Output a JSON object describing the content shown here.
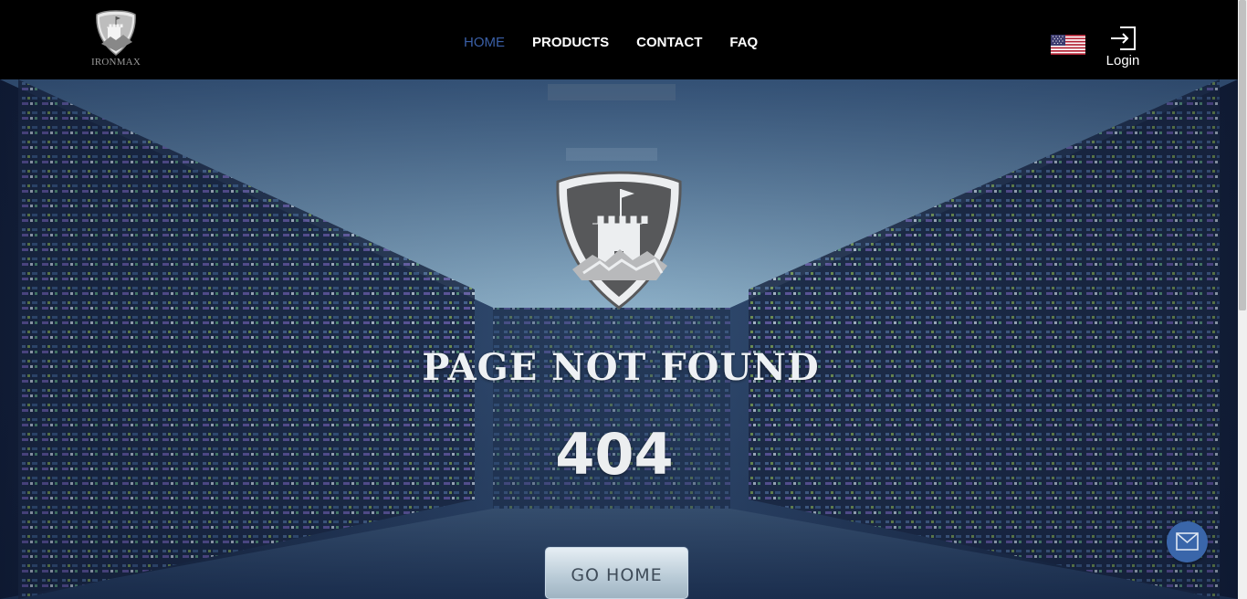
{
  "header": {
    "logo_text": "IRONMAX",
    "nav": [
      {
        "label": "HOME",
        "active": true
      },
      {
        "label": "PRODUCTS",
        "active": false
      },
      {
        "label": "CONTACT",
        "active": false
      },
      {
        "label": "FAQ",
        "active": false
      }
    ],
    "language_flag": "us-flag-icon",
    "login_label": "Login",
    "login_icon": "login-arrow-icon"
  },
  "main": {
    "title": "PAGE NOT FOUND",
    "code": "404",
    "button_label": "GO HOME",
    "crest_icon": "castle-shield-icon"
  },
  "chat_widget": {
    "icon": "mail-icon"
  },
  "colors": {
    "header_bg": "#000000",
    "nav_active": "#3a5fa6",
    "nav_text": "#ffffff",
    "chat_button": "#3a66aa"
  }
}
